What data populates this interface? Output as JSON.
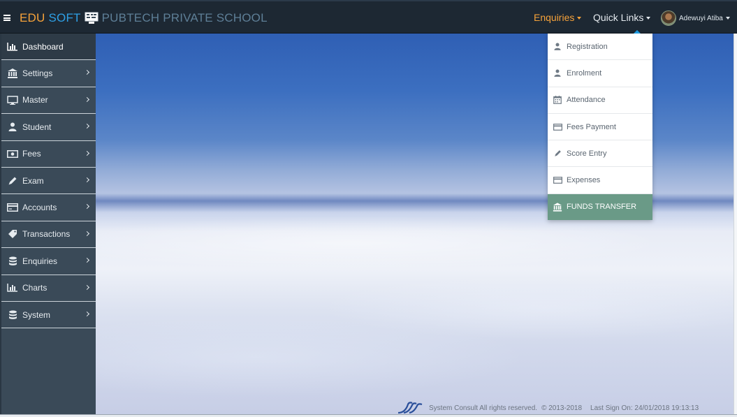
{
  "header": {
    "brand_edu": "EDU",
    "brand_soft": "SOFT",
    "school_name": "PUBTECH PRIVATE SCHOOL",
    "nav_enquiries": "Enquiries",
    "nav_quick_links": "Quick Links",
    "user_name": "Adewuyi Atiba"
  },
  "sidebar": {
    "items": [
      {
        "label": "Dashboard",
        "icon": "bar-chart-icon"
      },
      {
        "label": "Settings",
        "icon": "bank-icon"
      },
      {
        "label": "Master",
        "icon": "monitor-icon"
      },
      {
        "label": "Student",
        "icon": "user-icon"
      },
      {
        "label": "Fees",
        "icon": "money-icon"
      },
      {
        "label": "Exam",
        "icon": "pencil-icon"
      },
      {
        "label": "Accounts",
        "icon": "credit-card-icon"
      },
      {
        "label": "Transactions",
        "icon": "tag-icon"
      },
      {
        "label": "Enquiries",
        "icon": "database-icon"
      },
      {
        "label": "Charts",
        "icon": "bar-chart-icon"
      },
      {
        "label": "System",
        "icon": "database-icon"
      }
    ]
  },
  "quick_links": {
    "items": [
      {
        "label": "Registration",
        "icon": "user-icon"
      },
      {
        "label": "Enrolment",
        "icon": "user-icon"
      },
      {
        "label": "Attendance",
        "icon": "calendar-icon"
      },
      {
        "label": "Fees Payment",
        "icon": "credit-card-icon"
      },
      {
        "label": "Score Entry",
        "icon": "pencil-icon"
      },
      {
        "label": "Expenses",
        "icon": "credit-card-icon"
      },
      {
        "label": "FUNDS TRANSFER",
        "icon": "bank-icon"
      }
    ]
  },
  "footer": {
    "company": "System Consult All rights reserved.",
    "copyright": "© 2013-2018",
    "last_sign_on": "Last Sign On: 24/01/2018 19:13:13"
  },
  "colors": {
    "header_bg": "#1d2833",
    "sidebar_bg": "#3a4a58",
    "brand_orange": "#f6a23a",
    "brand_blue": "#2ea0e6",
    "highlight_green": "#6a9a87"
  }
}
